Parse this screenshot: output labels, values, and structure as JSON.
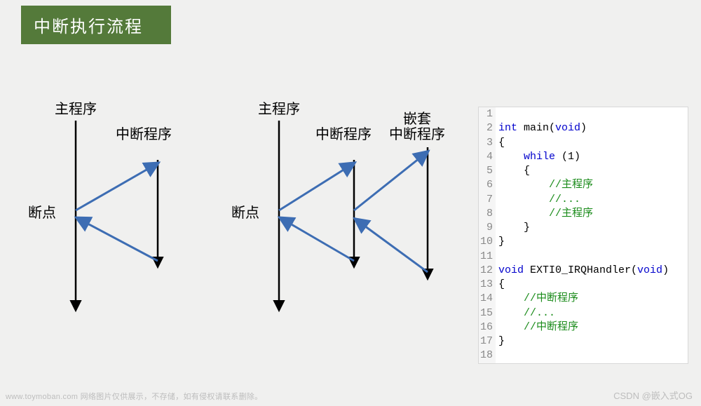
{
  "title": "中断执行流程",
  "labels": {
    "main_program": "主程序",
    "isr": "中断程序",
    "nested_line1": "嵌套",
    "nested_line2": "中断程序",
    "breakpoint": "断点"
  },
  "code": {
    "lines": [
      {
        "n": 1,
        "plain": ""
      },
      {
        "n": 2,
        "kw1": "int",
        "mid": " main(",
        "kw2": "void",
        "tail": ")"
      },
      {
        "n": 3,
        "plain": "{"
      },
      {
        "n": 4,
        "indent": "    ",
        "kw1": "while",
        "tail": " (1)"
      },
      {
        "n": 5,
        "plain": "    {"
      },
      {
        "n": 6,
        "indent": "        ",
        "comment": "//主程序"
      },
      {
        "n": 7,
        "indent": "        ",
        "comment": "//..."
      },
      {
        "n": 8,
        "indent": "        ",
        "comment": "//主程序"
      },
      {
        "n": 9,
        "plain": "    }"
      },
      {
        "n": 10,
        "plain": "}"
      },
      {
        "n": 11,
        "plain": ""
      },
      {
        "n": 12,
        "kw1": "void",
        "mid": " EXTI0_IRQHandler(",
        "kw2": "void",
        "tail": ")"
      },
      {
        "n": 13,
        "plain": "{"
      },
      {
        "n": 14,
        "indent": "    ",
        "comment": "//中断程序"
      },
      {
        "n": 15,
        "indent": "    ",
        "comment": "//..."
      },
      {
        "n": 16,
        "indent": "    ",
        "comment": "//中断程序"
      },
      {
        "n": 17,
        "plain": "}"
      },
      {
        "n": 18,
        "plain": ""
      }
    ]
  },
  "watermark_left": "www.toymoban.com  网络图片仅供展示，不存储，如有侵权请联系删除。",
  "watermark_right": "CSDN @嵌入式OG",
  "chart_data": {
    "type": "diagram",
    "title": "中断执行流程",
    "panels": [
      {
        "name": "single-interrupt",
        "main": "主程序",
        "breakpoint_label": "断点",
        "isr": "中断程序",
        "flow": [
          "主程序运行",
          "到断点→跳转中断程序",
          "中断程序结束→返回主程序继续"
        ]
      },
      {
        "name": "nested-interrupt",
        "main": "主程序",
        "breakpoint_label": "断点",
        "isr": "中断程序",
        "nested_isr": "嵌套中断程序",
        "flow": [
          "主程序运行",
          "到断点→跳转中断程序",
          "中断程序中→跳转嵌套中断程序",
          "嵌套中断程序结束→返回中断程序",
          "中断程序结束→返回主程序继续"
        ]
      }
    ]
  }
}
